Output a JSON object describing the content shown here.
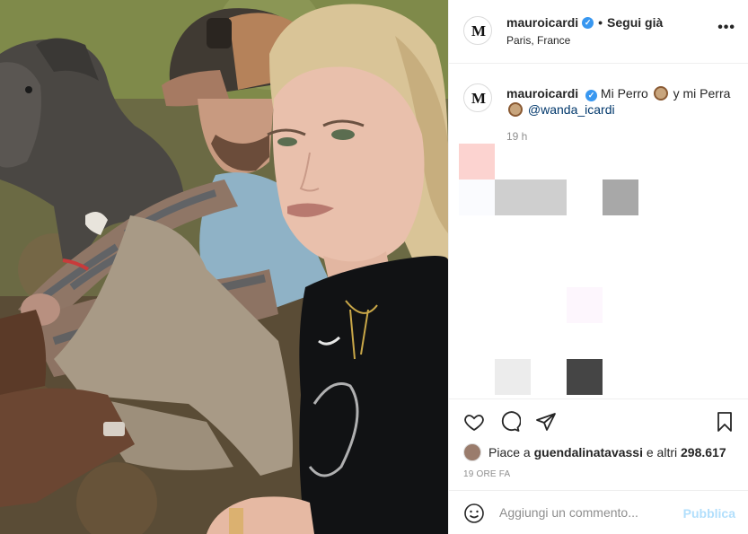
{
  "post": {
    "photo_alt": "",
    "author": {
      "username": "mauroicardi",
      "monogram": "M",
      "verified": true,
      "follow_status": "Segui già",
      "location": "Paris, France"
    },
    "more_options_icon": "more-horizontal-icon",
    "caption": {
      "username": "mauroicardi",
      "text_part1": "Mi Perro",
      "text_part2": "y mi Perra",
      "mention": "@wanda_icardi",
      "time": "19 h"
    },
    "actions": {
      "like_icon": "heart-icon",
      "comment_icon": "comment-icon",
      "share_icon": "paper-plane-icon",
      "save_icon": "bookmark-icon"
    },
    "likes": {
      "prefix": "Piace a",
      "user": "guendalinatavassi",
      "middle": "e altri",
      "count": "298.617"
    },
    "posted_ago": "19 ORE FA",
    "comment": {
      "placeholder": "Aggiungi un commento...",
      "publish_label": "Pubblica"
    }
  },
  "colors": {
    "accent": "#3897f0",
    "publish_disabled": "#b2dffc",
    "mention": "#00376b",
    "text_secondary": "#8e8e8e",
    "border": "#efefef"
  }
}
